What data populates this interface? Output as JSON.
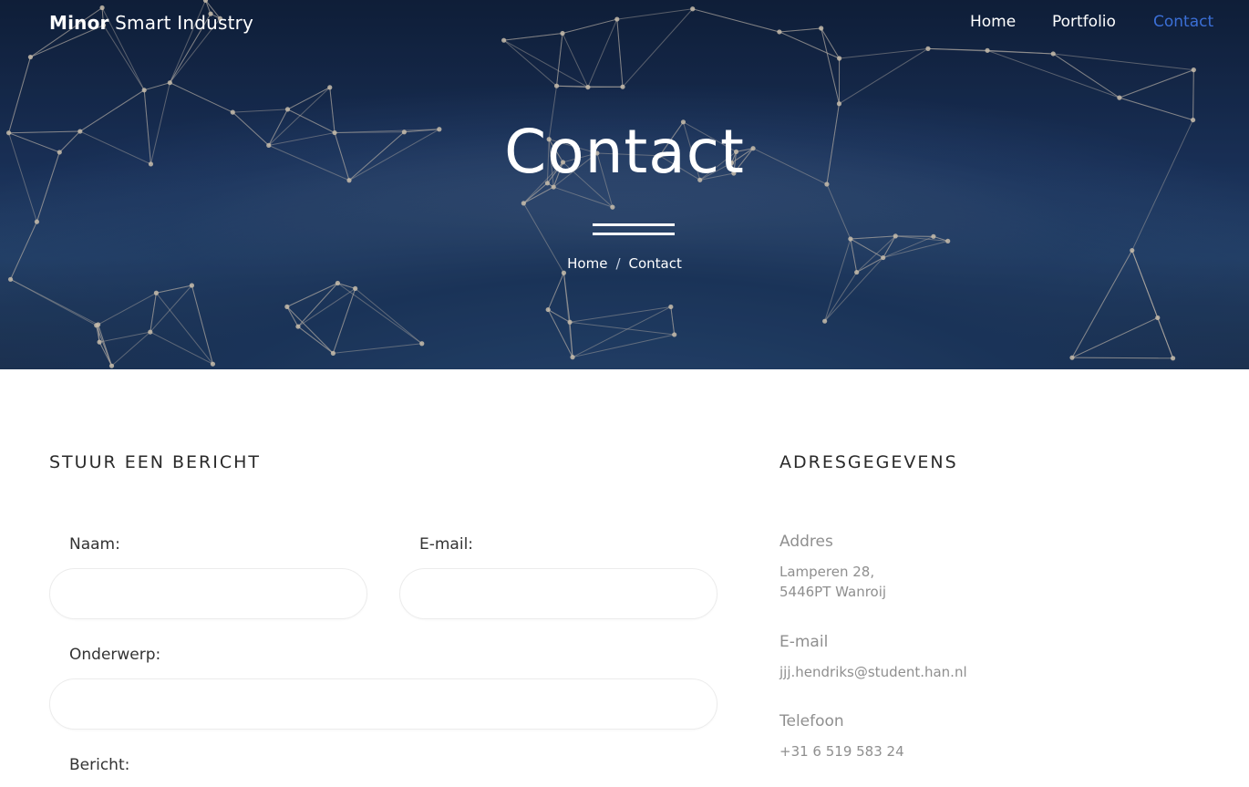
{
  "nav": {
    "brand_bold": "Minor",
    "brand_rest": " Smart Industry",
    "links": [
      {
        "label": "Home",
        "active": false
      },
      {
        "label": "Portfolio",
        "active": false
      },
      {
        "label": "Contact",
        "active": true
      }
    ]
  },
  "hero": {
    "title": "Contact",
    "breadcrumb": {
      "home": "Home",
      "separator": "/",
      "current": "Contact"
    }
  },
  "form": {
    "heading": "STUUR EEN BERICHT",
    "name_label": "Naam:",
    "name_value": "",
    "email_label": "E-mail:",
    "email_value": "",
    "subject_label": "Onderwerp:",
    "subject_value": "",
    "message_label": "Bericht:"
  },
  "address": {
    "heading": "ADRESGEGEVENS",
    "address_label": "Addres",
    "address_line1": "Lamperen 28,",
    "address_line2": "5446PT Wanroij",
    "email_label": "E-mail",
    "email_value": "jjj.hendriks@student.han.nl",
    "phone_label": "Telefoon",
    "phone_value": "+31 6 519 583 24"
  },
  "colors": {
    "accent": "#3b6fd6",
    "muted_text": "#8f8f8f"
  }
}
